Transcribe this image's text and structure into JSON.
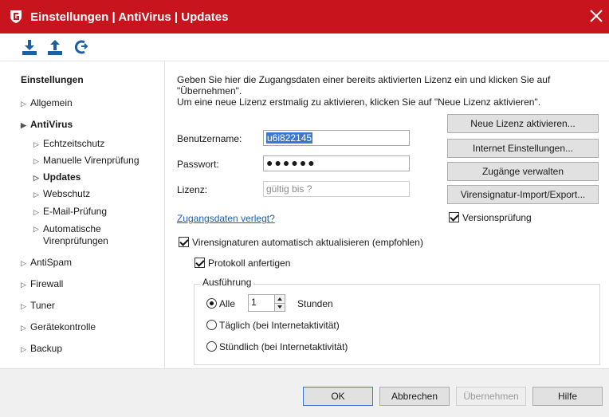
{
  "window": {
    "title": "Einstellungen | AntiVirus | Updates",
    "accent_color": "#c8141c"
  },
  "toolbar": {
    "icons": [
      "download-icon",
      "upload-icon",
      "reset-icon"
    ]
  },
  "sidebar": {
    "heading": "Einstellungen",
    "items": [
      {
        "label": "Allgemein"
      },
      {
        "label": "AntiVirus"
      },
      {
        "label": "Echtzeitschutz"
      },
      {
        "label": "Manuelle Virenprüfung"
      },
      {
        "label": "Updates"
      },
      {
        "label": "Webschutz"
      },
      {
        "label": "E-Mail-Prüfung"
      },
      {
        "label": "Automatische Virenprüfungen"
      },
      {
        "label": "AntiSpam"
      },
      {
        "label": "Firewall"
      },
      {
        "label": "Tuner"
      },
      {
        "label": "Gerätekontrolle"
      },
      {
        "label": "Backup"
      }
    ]
  },
  "main": {
    "intro_line1": "Geben Sie hier die Zugangsdaten einer bereits aktivierten Lizenz ein und klicken Sie auf \"Übernehmen\".",
    "intro_line2": "Um eine neue Lizenz erstmalig zu aktivieren, klicken Sie auf \"Neue Lizenz aktivieren\".",
    "username_label": "Benutzername:",
    "username_value": "u6i822145",
    "password_label": "Passwort:",
    "password_value": "●●●●●●",
    "license_label": "Lizenz:",
    "license_value": "gültig bis ?",
    "forgot_link": "Zugangsdaten verlegt?",
    "btn_new_license": "Neue Lizenz aktivieren...",
    "btn_internet": "Internet Einstellungen...",
    "btn_access": "Zugänge verwalten",
    "btn_import": "Virensignatur-Import/Export...",
    "version_check": "Versionsprüfung",
    "auto_update": "Virensignaturen automatisch aktualisieren (empfohlen)",
    "protocol": "Protokoll anfertigen",
    "execution_legend": "Ausführung",
    "option_all": "Alle",
    "interval_value": "1",
    "interval_unit": "Stunden",
    "option_daily": "Täglich (bei Internetaktivität)",
    "option_hourly": "Stündlich (bei Internetaktivität)"
  },
  "footer": {
    "ok": "OK",
    "cancel": "Abbrechen",
    "apply": "Übernehmen",
    "help": "Hilfe"
  }
}
